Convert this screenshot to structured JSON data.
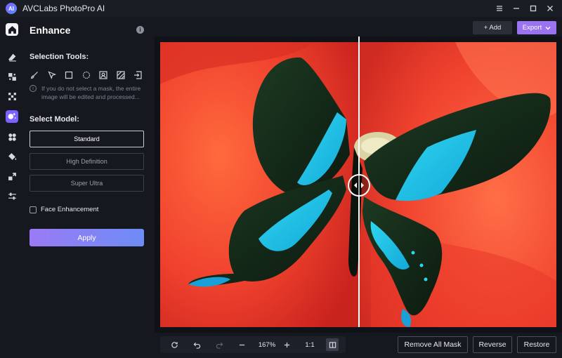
{
  "app": {
    "title": "AVCLabs PhotoPro AI",
    "logo_text": "AI"
  },
  "window_controls": [
    "menu-icon",
    "minimize-icon",
    "maximize-icon",
    "close-icon"
  ],
  "rail": [
    {
      "name": "home",
      "icon": "home-icon"
    },
    {
      "name": "erase",
      "icon": "eraser-icon"
    },
    {
      "name": "replace",
      "icon": "replace-icon"
    },
    {
      "name": "remove",
      "icon": "remove-icon"
    },
    {
      "name": "enhance",
      "icon": "enhance-icon",
      "active": true
    },
    {
      "name": "colorize",
      "icon": "colorize-icon"
    },
    {
      "name": "recolor",
      "icon": "paint-bucket-icon"
    },
    {
      "name": "resize",
      "icon": "resize-icon"
    },
    {
      "name": "adjust",
      "icon": "sliders-icon"
    }
  ],
  "panel": {
    "title": "Enhance",
    "info_icon": "i",
    "selection_label": "Selection Tools:",
    "tools": [
      "brush-icon",
      "lasso-icon",
      "rectangle-icon",
      "ellipse-icon",
      "portrait-icon",
      "pattern-icon",
      "import-icon"
    ],
    "hint": "If you do not select a mask, the entire image will be edited and processed...",
    "model_label": "Select Model:",
    "models": [
      {
        "label": "Standard",
        "selected": true
      },
      {
        "label": "High Definition",
        "selected": false
      },
      {
        "label": "Super Ultra",
        "selected": false
      }
    ],
    "face_enhancement_label": "Face Enhancement",
    "face_enhancement_checked": false,
    "apply_label": "Apply"
  },
  "topbar": {
    "add_label": "+ Add",
    "export_label": "Export"
  },
  "zoom": {
    "level": "167%",
    "ratio_label": "1:1"
  },
  "actions": {
    "remove_all_mask": "Remove All Mask",
    "reverse": "Reverse",
    "restore": "Restore"
  },
  "colors": {
    "accent": "#9a73f0",
    "apply_start": "#9b7af5",
    "apply_end": "#6d8cf5",
    "background": "#15181f"
  }
}
